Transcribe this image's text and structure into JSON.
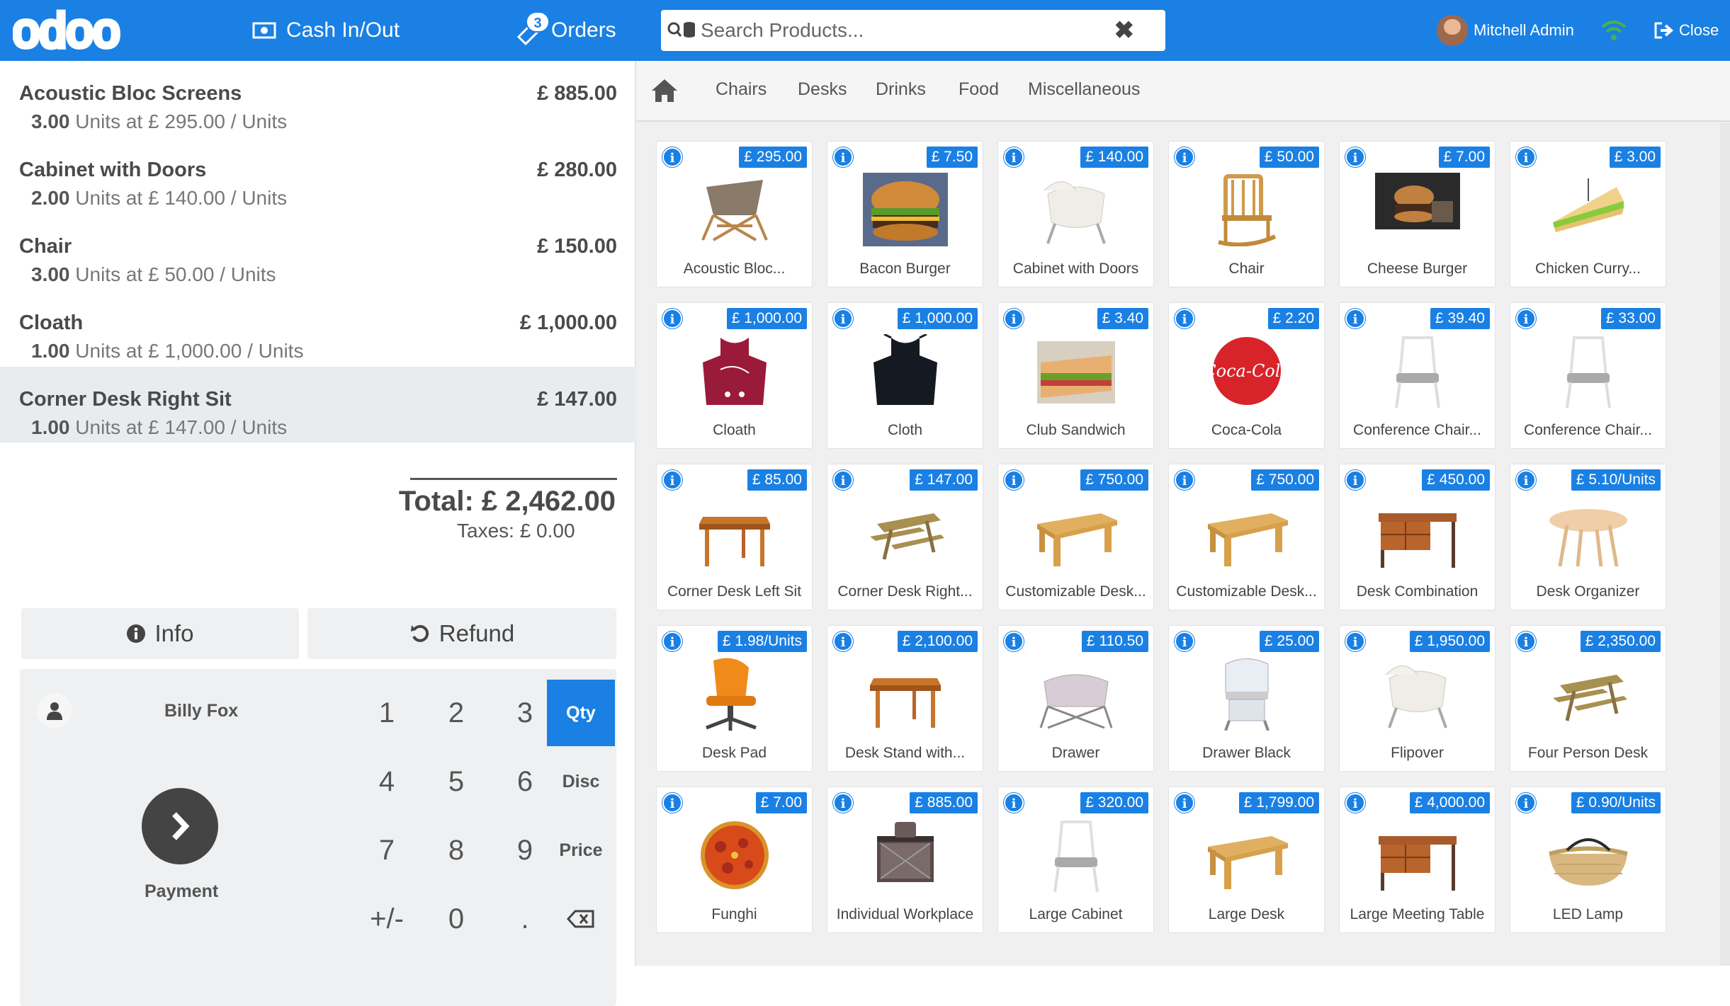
{
  "header": {
    "logo": "odoo",
    "cash_label": "Cash In/Out",
    "orders_label": "Orders",
    "orders_count": "3",
    "search_placeholder": "Search Products...",
    "user_name": "Mitchell Admin",
    "close_label": "Close"
  },
  "order": {
    "lines": [
      {
        "name": "Acoustic Bloc Screens",
        "price": "£ 885.00",
        "qty": "3.00",
        "detail": "Units at £ 295.00 / Units",
        "selected": false
      },
      {
        "name": "Cabinet with Doors",
        "price": "£ 280.00",
        "qty": "2.00",
        "detail": "Units at £ 140.00 / Units",
        "selected": false
      },
      {
        "name": "Chair",
        "price": "£ 150.00",
        "qty": "3.00",
        "detail": "Units at £ 50.00 / Units",
        "selected": false
      },
      {
        "name": "Cloath",
        "price": "£ 1,000.00",
        "qty": "1.00",
        "detail": "Units at £ 1,000.00 / Units",
        "selected": false
      },
      {
        "name": "Corner Desk Right Sit",
        "price": "£ 147.00",
        "qty": "1.00",
        "detail": "Units at £ 147.00 / Units",
        "selected": true
      }
    ],
    "total": "Total: £ 2,462.00",
    "taxes": "Taxes: £ 0.00"
  },
  "actions": {
    "info_label": "Info",
    "refund_label": "Refund"
  },
  "pad": {
    "customer": "Billy Fox",
    "payment_label": "Payment",
    "keys": [
      "1",
      "2",
      "3",
      "4",
      "5",
      "6",
      "7",
      "8",
      "9",
      "+/-",
      "0",
      "."
    ],
    "modes": [
      "Qty",
      "Disc",
      "Price"
    ],
    "active_mode": "Qty"
  },
  "categories": [
    "Chairs",
    "Desks",
    "Drinks",
    "Food",
    "Miscellaneous"
  ],
  "products": [
    {
      "name": "Acoustic Bloc...",
      "price": "£ 295.00",
      "icon": "wooden-stand"
    },
    {
      "name": "Bacon Burger",
      "price": "£ 7.50",
      "icon": "burger"
    },
    {
      "name": "Cabinet with Doors",
      "price": "£ 140.00",
      "icon": "cradle"
    },
    {
      "name": "Chair",
      "price": "£ 50.00",
      "icon": "rocking-chair"
    },
    {
      "name": "Cheese Burger",
      "price": "£ 7.00",
      "icon": "burger-dark"
    },
    {
      "name": "Chicken Curry...",
      "price": "£ 3.00",
      "icon": "sandwich"
    },
    {
      "name": "Cloath",
      "price": "£ 1,000.00",
      "icon": "apron-red"
    },
    {
      "name": "Cloth",
      "price": "£ 1,000.00",
      "icon": "apron-black"
    },
    {
      "name": "Club Sandwich",
      "price": "£ 3.40",
      "icon": "club-sandwich"
    },
    {
      "name": "Coca-Cola",
      "price": "£ 2.20",
      "icon": "coca-cola"
    },
    {
      "name": "Conference Chair...",
      "price": "£ 39.40",
      "icon": "white-chair"
    },
    {
      "name": "Conference Chair...",
      "price": "£ 33.00",
      "icon": "white-chair"
    },
    {
      "name": "Corner Desk Left Sit",
      "price": "£ 85.00",
      "icon": "wood-table"
    },
    {
      "name": "Corner Desk Right...",
      "price": "£ 147.00",
      "icon": "picnic-table"
    },
    {
      "name": "Customizable Desk...",
      "price": "£ 750.00",
      "icon": "light-desk"
    },
    {
      "name": "Customizable Desk...",
      "price": "£ 750.00",
      "icon": "light-desk"
    },
    {
      "name": "Desk Combination",
      "price": "£ 450.00",
      "icon": "drawer-desk"
    },
    {
      "name": "Desk Organizer",
      "price": "£ 5.10/Units",
      "icon": "round-table"
    },
    {
      "name": "Desk Pad",
      "price": "£ 1.98/Units",
      "icon": "office-chair"
    },
    {
      "name": "Desk Stand with...",
      "price": "£ 2,100.00",
      "icon": "wood-table"
    },
    {
      "name": "Drawer",
      "price": "£ 110.50",
      "icon": "bassinet"
    },
    {
      "name": "Drawer Black",
      "price": "£ 25.00",
      "icon": "crib"
    },
    {
      "name": "Flipover",
      "price": "£ 1,950.00",
      "icon": "cradle"
    },
    {
      "name": "Four Person Desk",
      "price": "£ 2,350.00",
      "icon": "picnic-table"
    },
    {
      "name": "Funghi",
      "price": "£ 7.00",
      "icon": "pizza"
    },
    {
      "name": "Individual Workplace",
      "price": "£ 885.00",
      "icon": "playpen"
    },
    {
      "name": "Large Cabinet",
      "price": "£ 320.00",
      "icon": "white-chair"
    },
    {
      "name": "Large Desk",
      "price": "£ 1,799.00",
      "icon": "light-desk"
    },
    {
      "name": "Large Meeting Table",
      "price": "£ 4,000.00",
      "icon": "drawer-desk"
    },
    {
      "name": "LED Lamp",
      "price": "£ 0.90/Units",
      "icon": "basket"
    }
  ],
  "colors": {
    "brand": "#1a80e3",
    "selected_line": "#e9ecef"
  }
}
